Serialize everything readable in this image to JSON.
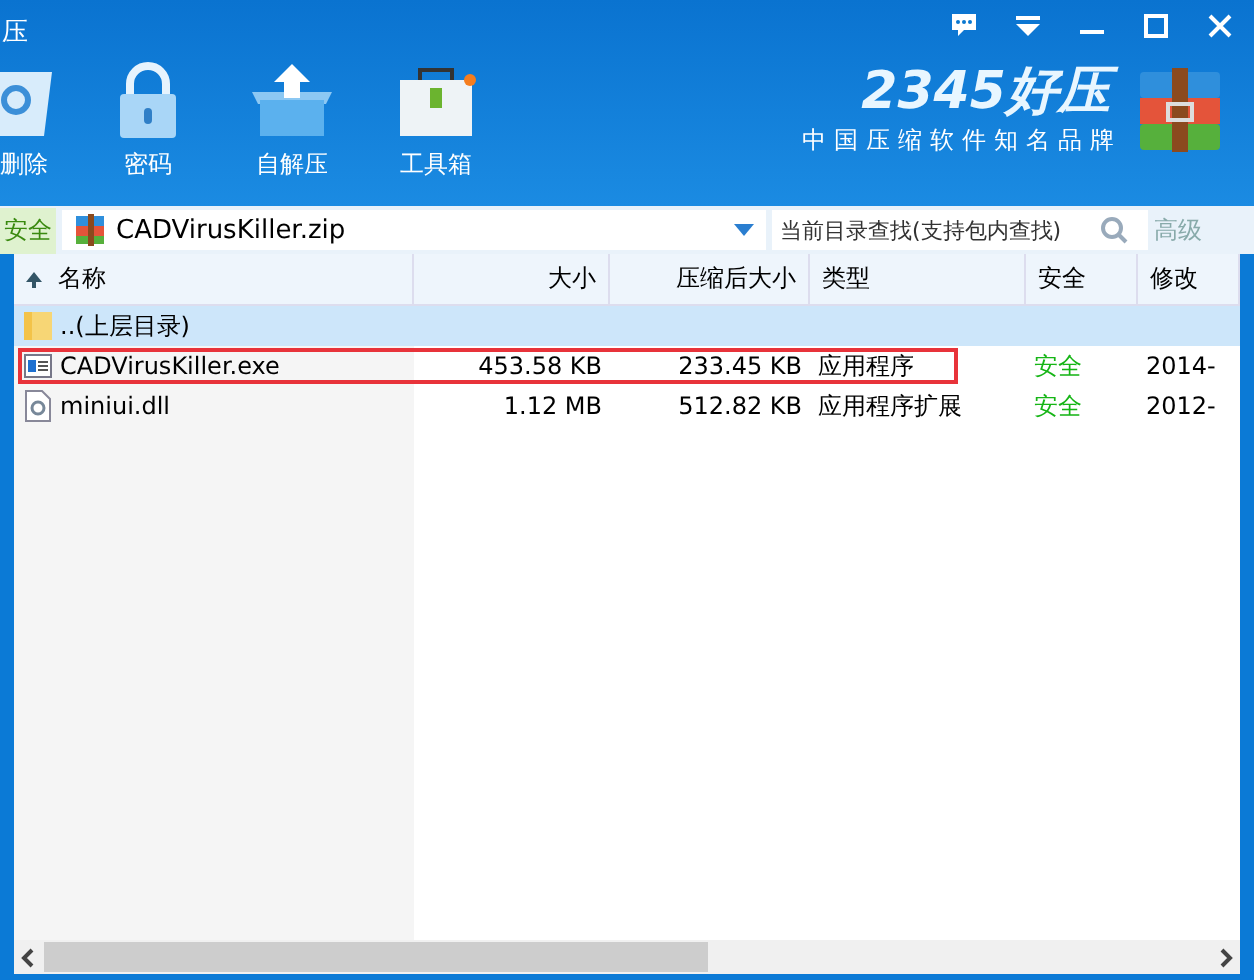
{
  "window": {
    "title": "压"
  },
  "toolbar": [
    {
      "label": "删除",
      "kind": "recycle"
    },
    {
      "label": "密码",
      "kind": "lock"
    },
    {
      "label": "自解压",
      "kind": "box"
    },
    {
      "label": "工具箱",
      "kind": "toolbox"
    }
  ],
  "logo": {
    "brand": "2345好压",
    "slogan": "中国压缩软件知名品牌"
  },
  "address": {
    "badge": "安全",
    "path": "CADVirusKiller.zip"
  },
  "search": {
    "placeholder": "当前目录查找(支持包内查找)",
    "advanced": "高级"
  },
  "table": {
    "columns": [
      {
        "label": "名称",
        "sorted": true
      },
      {
        "label": "大小",
        "sorted": false
      },
      {
        "label": "压缩后大小",
        "sorted": false
      },
      {
        "label": "类型",
        "sorted": false
      },
      {
        "label": "安全",
        "sorted": false
      },
      {
        "label": "修改",
        "sorted": false
      }
    ],
    "rows": [
      {
        "kind": "folder",
        "name": "..(上层目录)",
        "selected": true,
        "highlighted": false
      },
      {
        "kind": "exe",
        "name": "CADVirusKiller.exe",
        "size": "453.58 KB",
        "packed": "233.45 KB",
        "type": "应用程序",
        "safe": "安全",
        "modified": "2014-",
        "selected": false,
        "highlighted": true
      },
      {
        "kind": "dll",
        "name": "miniui.dll",
        "size": "1.12 MB",
        "packed": "512.82 KB",
        "type": "应用程序扩展",
        "safe": "安全",
        "modified": "2012-",
        "selected": false,
        "highlighted": false
      }
    ]
  }
}
